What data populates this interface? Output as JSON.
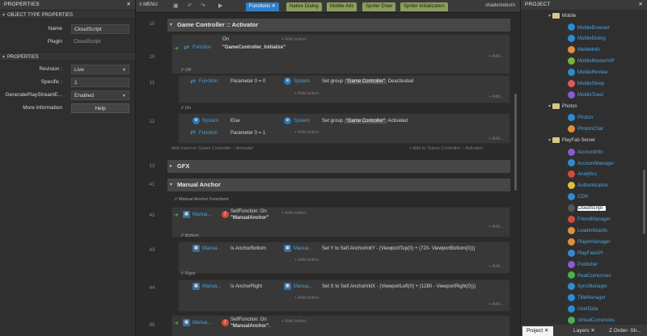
{
  "left_panel": {
    "title": "PROPERTIES",
    "close": "✕",
    "object_type_section": "OBJECT TYPE PROPERTIES",
    "name_label": "Name",
    "name_value": "CloudScript",
    "plugin_label": "Plugin",
    "plugin_value": "CloudScript",
    "properties_section": "PROPERTIES",
    "revision_label": "Revision :",
    "revision_value": "Live",
    "specific_label": "Specific :",
    "specific_value": "1",
    "generate_label": "GeneratePlayStreamE...",
    "generate_value": "Enabled",
    "more_info_label": "More information",
    "help_button": "Help"
  },
  "topbar": {
    "menu": "≡ MENU",
    "tabs": [
      "Functions",
      "Native Dialog",
      "Mobile Ads",
      "Spriter Draw",
      "Spriter Initialization"
    ],
    "tab_close": "✕",
    "user": "chadorireborn"
  },
  "sheet": {
    "rows": {
      "l10": "10",
      "l11": "11",
      "l12": "12",
      "l13": "13",
      "l41": "41",
      "l42": "42",
      "l43": "43",
      "l44": "44",
      "l45": "45"
    },
    "group_gc": "Game Controller :: Activator",
    "ev10_obj": "Function",
    "ev10_on": "On",
    "ev10_name": "\"GameController_Initialize\"",
    "add_action": "+ Add action",
    "add": "+ Add...",
    "off_comment": "// Off",
    "ev11_obj": "Function",
    "ev11_cond": "Parameter 0 = 0",
    "system": "System",
    "set_group": "Set group",
    "gc_str": "\"Game Controller\"",
    "deactivated": "Deactivated",
    "on_comment": "// On",
    "ev12_cond1": "Else",
    "ev12_obj": "Function",
    "ev12_cond2": "Parameter 0 = 1",
    "activated": "Activated",
    "add_event": "Add event to 'Game Controller :: Activator'",
    "add_to": "+ Add to 'Game Controller :: Activator'",
    "group_gfx": "GFX",
    "group_ma": "Manual Anchor",
    "ma_comment": "// Manual Anchor Functions",
    "manual": "Manua...",
    "self_fn": "SelfFunction: On",
    "ma_str": "\"ManualAnchor\"",
    "bottom_comment": "// Bottom",
    "is_ab": "Is AnchorBottom",
    "set_y": "Set Y to Self.AnchorInitY - (ViewportTop(0) + (720- ViewportBottom(0)))",
    "right_comment": "// Right",
    "is_ar": "Is AnchorRight",
    "set_x": "Set X to Self.AnchorInitX - (ViewportLeft(0) + (1280 - ViewportRight(0)))",
    "ma_str2": "\"ManualAnchor\"."
  },
  "right_panel": {
    "title": "PROJECT",
    "close": "✕",
    "items": [
      {
        "label": "Mobile",
        "type": "folder"
      },
      {
        "label": "MobileBrowser",
        "color": "#2e8bd0"
      },
      {
        "label": "MobileDialog",
        "color": "#2e8bd0"
      },
      {
        "label": "MobileInfo",
        "color": "#e0903a"
      },
      {
        "label": "MobileMasterIAP",
        "color": "#7ab23a"
      },
      {
        "label": "MobileReview",
        "color": "#2e8bd0"
      },
      {
        "label": "MobileSleep",
        "color": "#e05a5a"
      },
      {
        "label": "MobileToast",
        "color": "#8b5ad0"
      },
      {
        "label": "Photon",
        "type": "folder"
      },
      {
        "label": "Photon",
        "color": "#2e8bd0"
      },
      {
        "label": "PhotonChat",
        "color": "#e0903a"
      },
      {
        "label": "PlayFab Server",
        "type": "folder"
      },
      {
        "label": "AccountInfo",
        "color": "#8b5ad0"
      },
      {
        "label": "AccountManager",
        "color": "#2e8bd0"
      },
      {
        "label": "Analytics",
        "color": "#d24b3a"
      },
      {
        "label": "Authentication",
        "color": "#e0c03a"
      },
      {
        "label": "CDN",
        "color": "#2e8bd0"
      },
      {
        "label": "CloudScript",
        "color": "#555555",
        "selected": true
      },
      {
        "label": "FriendManager",
        "color": "#d24b3a"
      },
      {
        "label": "Leaderboards",
        "color": "#e0903a"
      },
      {
        "label": "PlayerManager",
        "color": "#e0903a"
      },
      {
        "label": "PlayFabAPI",
        "color": "#2e8bd0"
      },
      {
        "label": "Publisher",
        "color": "#8b5ad0"
      },
      {
        "label": "RealCurrencies",
        "color": "#4caf50"
      },
      {
        "label": "SyncManager",
        "color": "#2e8bd0"
      },
      {
        "label": "TitleManager",
        "color": "#2e8bd0"
      },
      {
        "label": "UserData",
        "color": "#2e8bd0"
      },
      {
        "label": "VirtualCurrencies",
        "color": "#4caf50"
      }
    ],
    "bottom_tabs": [
      "Project",
      "Layers",
      "Z Order- Sh..."
    ],
    "tab_close": "✕"
  }
}
